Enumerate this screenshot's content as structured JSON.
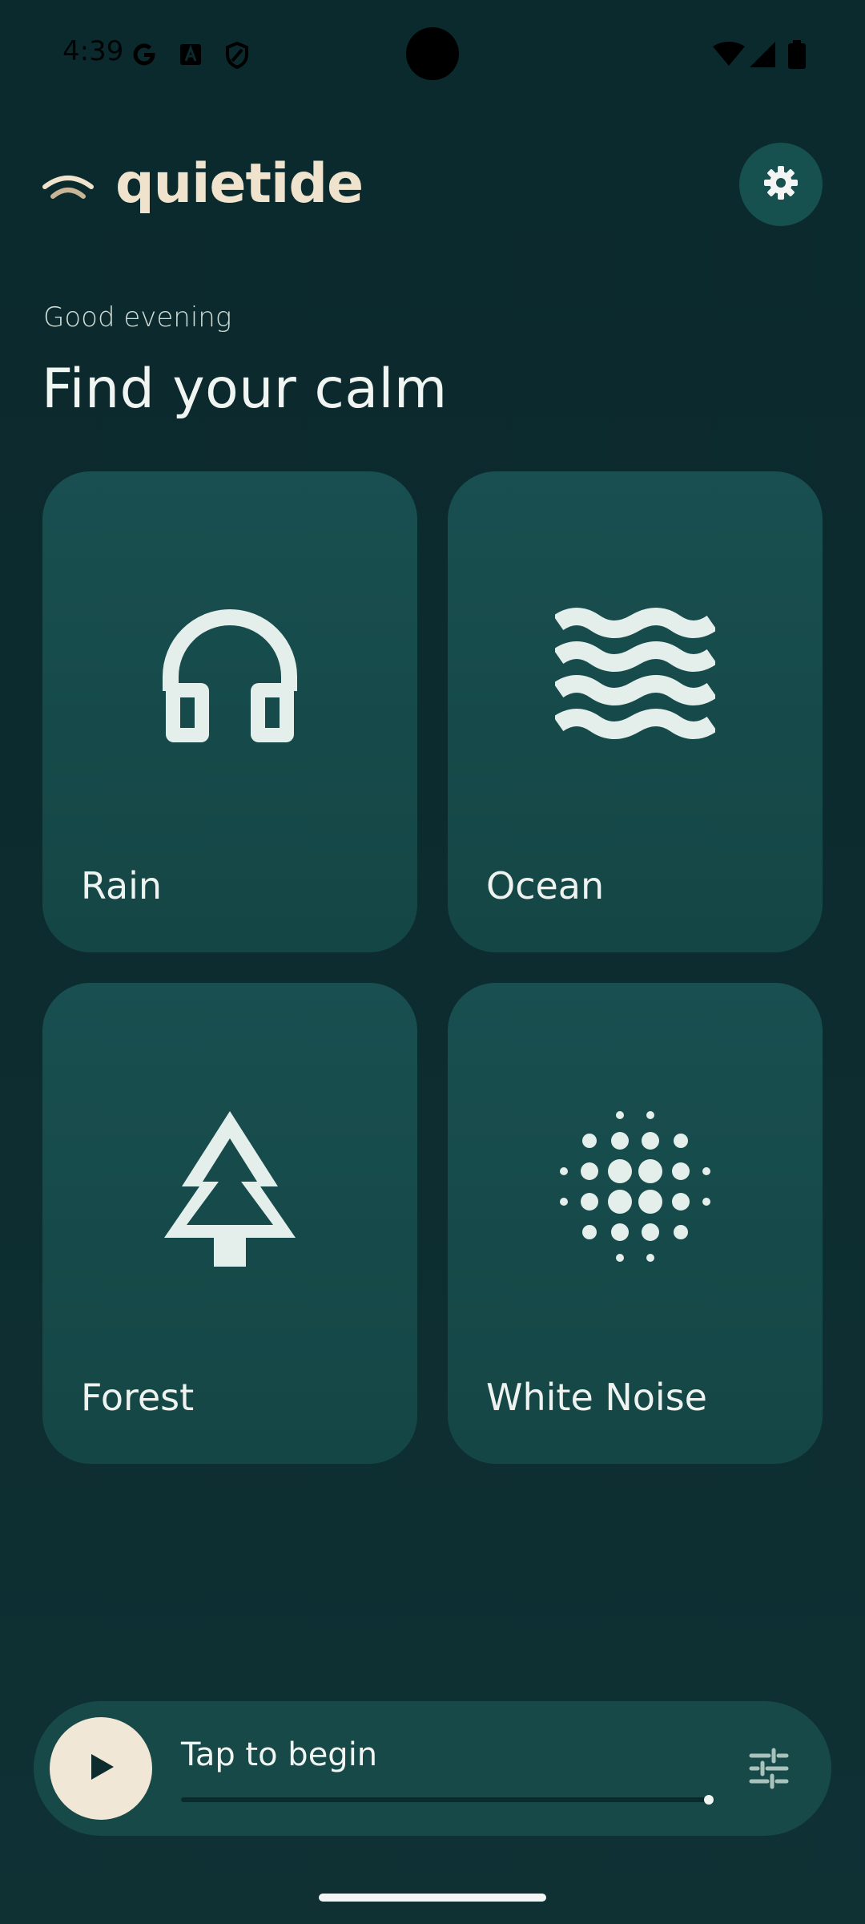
{
  "status_bar": {
    "time": "4:39",
    "icons": [
      "google-icon",
      "font-icon",
      "shield-icon",
      "wifi-icon",
      "signal-icon",
      "battery-icon"
    ]
  },
  "header": {
    "app_name": "quietide",
    "logo_icon": "wave-arc-icon",
    "settings_icon": "gear-icon"
  },
  "greeting": "Good evening",
  "headline": "Find your calm",
  "sounds": [
    {
      "label": "Rain",
      "icon": "headphones-icon"
    },
    {
      "label": "Ocean",
      "icon": "waves-icon"
    },
    {
      "label": "Forest",
      "icon": "tree-icon"
    },
    {
      "label": "White Noise",
      "icon": "dots-icon"
    }
  ],
  "player": {
    "title": "Tap to begin",
    "progress": 0.99,
    "play_icon": "play-icon",
    "mixer_icon": "sliders-icon"
  },
  "colors": {
    "background": "#0b2a2e",
    "card": "#194f50",
    "accent_cream": "#efe3cd",
    "icon_light": "#e4eeea"
  }
}
